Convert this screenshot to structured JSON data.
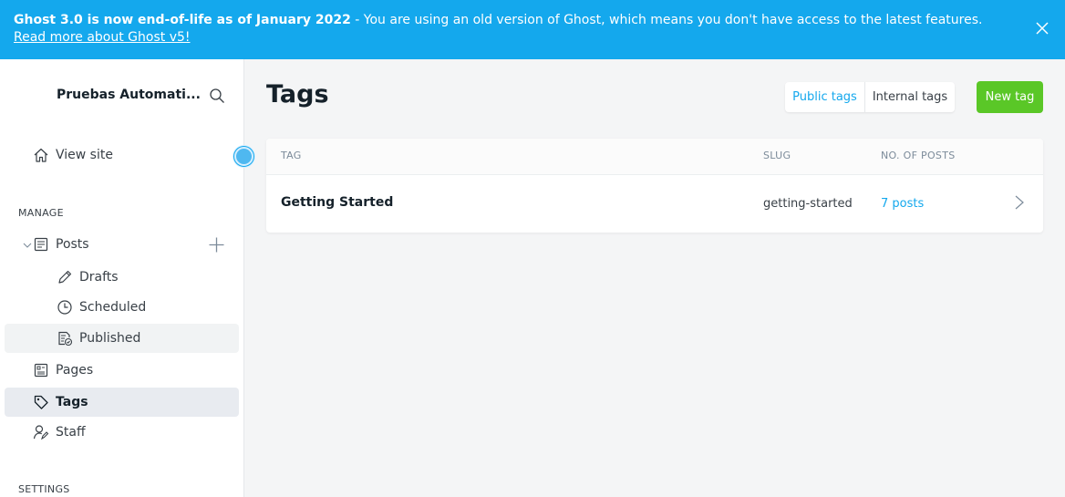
{
  "banner": {
    "bold": "Ghost 3.0 is now end-of-life as of January 2022",
    "text": " - You are using an old version of Ghost, which means you don't have access to the latest features. ",
    "link": "Read more about Ghost v5!"
  },
  "sidebar": {
    "site_title": "Pruebas Automati...",
    "view_site": "View site",
    "manage_label": "MANAGE",
    "settings_label": "SETTINGS",
    "posts": "Posts",
    "drafts": "Drafts",
    "scheduled": "Scheduled",
    "published": "Published",
    "pages": "Pages",
    "tags": "Tags",
    "staff": "Staff"
  },
  "main": {
    "title": "Tags",
    "public_tags": "Public tags",
    "internal_tags": "Internal tags",
    "new_tag": "New tag",
    "columns": [
      "TAG",
      "SLUG",
      "NO. OF POSTS"
    ],
    "rows": [
      {
        "name": "Getting Started",
        "slug": "getting-started",
        "posts": "7 posts"
      }
    ]
  },
  "colors": {
    "banner": "#14a8ed",
    "accent": "#14a8ed",
    "new_tag": "#5ac727"
  }
}
